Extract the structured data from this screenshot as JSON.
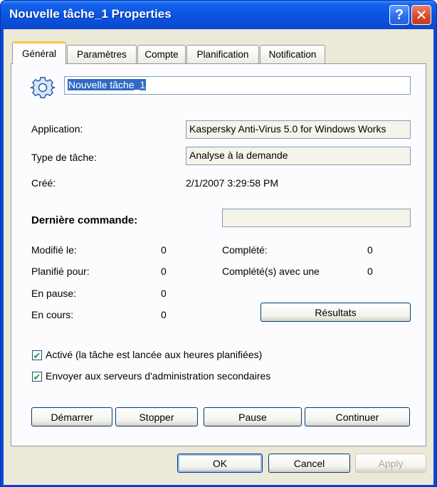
{
  "window": {
    "title": "Nouvelle tâche_1 Properties",
    "help_label": "?",
    "close_label": "✕"
  },
  "tabs": [
    {
      "label": "Général",
      "active": true
    },
    {
      "label": "Paramètres",
      "active": false
    },
    {
      "label": "Compte",
      "active": false
    },
    {
      "label": "Planification",
      "active": false
    },
    {
      "label": "Notification",
      "active": false
    }
  ],
  "general": {
    "icon": "gear-icon",
    "task_name": "Nouvelle tâche_1",
    "application_label": "Application:",
    "application_value": "Kaspersky Anti-Virus 5.0 for Windows Works",
    "task_type_label": "Type de tâche:",
    "task_type_value": "Analyse à la demande",
    "created_label": "Créé:",
    "created_value": "2/1/2007 3:29:58 PM",
    "last_command_label": "Dernière commande:",
    "last_command_value": "",
    "modified_label": "Modifié le:",
    "modified_value": "0",
    "planned_label": "Planifié pour:",
    "planned_value": "0",
    "paused_label": "En pause:",
    "paused_value": "0",
    "running_label": "En cours:",
    "running_value": "0",
    "completed_label": "Complété:",
    "completed_value": "0",
    "completed_error_label": "Complété(s) avec une",
    "completed_error_value": "0",
    "results_button": "Résultats",
    "active_checkbox": {
      "label": "Activé (la tâche est lancée aux heures planifiées)",
      "checked": true
    },
    "send_checkbox": {
      "label": "Envoyer aux serveurs d'administration secondaires",
      "checked": true
    },
    "start_button": "Démarrer",
    "stop_button": "Stopper",
    "pause_button": "Pause",
    "continue_button": "Continuer"
  },
  "footer": {
    "ok": "OK",
    "cancel": "Cancel",
    "apply": "Apply"
  },
  "colors": {
    "titlebar": "#0A54E3",
    "dialog_bg": "#ECE9D8",
    "checkmark": "#21A121",
    "tab_highlight": "#FFC83C"
  }
}
